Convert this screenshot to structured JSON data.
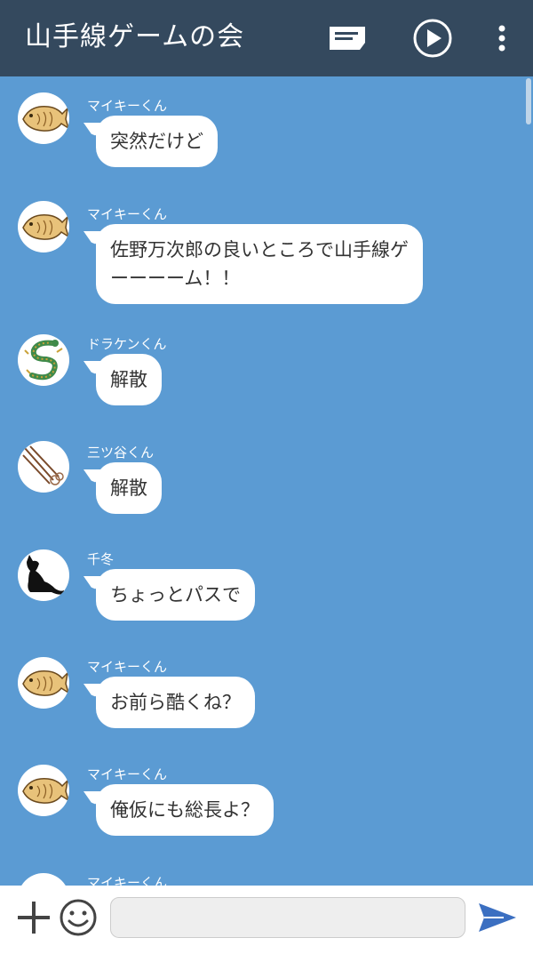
{
  "header": {
    "title": "山手線ゲームの会"
  },
  "messages": [
    {
      "sender": "マイキーくん",
      "text": "突然だけど",
      "avatar": "taiyaki-icon"
    },
    {
      "sender": "マイキーくん",
      "text_line1": "佐野万次郎の良いところで山手線ゲ",
      "text_line2": "ーーーーム！！",
      "avatar": "taiyaki-icon"
    },
    {
      "sender": "ドラケンくん",
      "text": "解散",
      "avatar": "dragon-icon"
    },
    {
      "sender": "三ツ谷くん",
      "text": "解散",
      "avatar": "needles-icon"
    },
    {
      "sender": "千冬",
      "text": "ちょっとパスで",
      "avatar": "cat-icon"
    },
    {
      "sender": "マイキーくん",
      "text": "お前ら酷くね？",
      "avatar": "taiyaki-icon"
    },
    {
      "sender": "マイキーくん",
      "text": "俺仮にも総長よ？",
      "avatar": "taiyaki-icon"
    },
    {
      "sender": "マイキーくん",
      "text": "",
      "avatar": "taiyaki-icon"
    }
  ],
  "footer": {
    "input_value": "",
    "input_placeholder": ""
  },
  "colors": {
    "header_bg": "#34495e",
    "chat_bg": "#5b9bd3",
    "send_accent": "#3b6fc1"
  }
}
